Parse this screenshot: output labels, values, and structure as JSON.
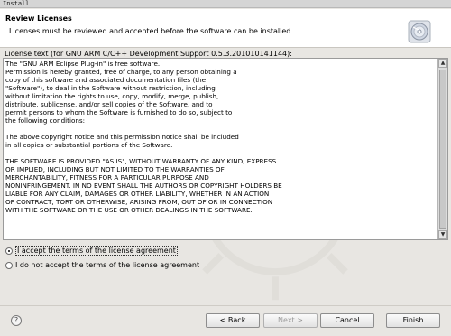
{
  "window": {
    "title": "Install"
  },
  "banner": {
    "title": "Review Licenses",
    "description": "Licenses must be reviewed and accepted before the software can be installed.",
    "icon": "cd-disc-icon"
  },
  "license": {
    "label": "License text (for GNU ARM C/C++ Development Support 0.5.3.201010141144):",
    "text": "The \"GNU ARM Eclipse Plug-in\" is free software.\nPermission is hereby granted, free of charge, to any person obtaining a\ncopy of this software and associated documentation files (the\n\"Software\"), to deal in the Software without restriction, including\nwithout limitation the rights to use, copy, modify, merge, publish,\ndistribute, sublicense, and/or sell copies of the Software, and to\npermit persons to whom the Software is furnished to do so, subject to\nthe following conditions:\n\nThe above copyright notice and this permission notice shall be included\nin all copies or substantial portions of the Software.\n\nTHE SOFTWARE IS PROVIDED \"AS IS\", WITHOUT WARRANTY OF ANY KIND, EXPRESS\nOR IMPLIED, INCLUDING BUT NOT LIMITED TO THE WARRANTIES OF\nMERCHANTABILITY, FITNESS FOR A PARTICULAR PURPOSE AND\nNONINFRINGEMENT. IN NO EVENT SHALL THE AUTHORS OR COPYRIGHT HOLDERS BE\nLIABLE FOR ANY CLAIM, DAMAGES OR OTHER LIABILITY, WHETHER IN AN ACTION\nOF CONTRACT, TORT OR OTHERWISE, ARISING FROM, OUT OF OR IN CONNECTION\nWITH THE SOFTWARE OR THE USE OR OTHER DEALINGS IN THE SOFTWARE."
  },
  "options": {
    "accept": {
      "label": "I accept the terms of the license agreement",
      "selected": true
    },
    "decline": {
      "label": "I do not accept the terms of the license agreement",
      "selected": false
    }
  },
  "buttons": {
    "help": "?",
    "back": "< Back",
    "next": "Next >",
    "cancel": "Cancel",
    "finish": "Finish"
  },
  "colors": {
    "banner_bg": "#ffffff",
    "window_bg": "#e8e6e2",
    "disabled_text": "#9a9a9a"
  }
}
